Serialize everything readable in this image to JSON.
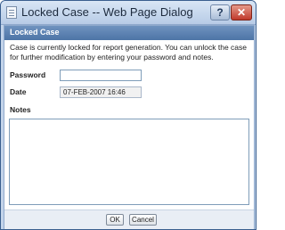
{
  "window": {
    "title": "Locked Case -- Web Page Dialog",
    "help_label": "?",
    "close_label": "✕"
  },
  "dialog": {
    "header": "Locked Case",
    "message": "Case is currently locked for report generation. You can unlock the case for further modification by entering your password and notes."
  },
  "form": {
    "password_label": "Password",
    "password_value": "",
    "date_label": "Date",
    "date_value": "07-FEB-2007 16:46",
    "notes_label": "Notes",
    "notes_value": ""
  },
  "buttons": {
    "ok": "OK",
    "cancel": "Cancel"
  }
}
